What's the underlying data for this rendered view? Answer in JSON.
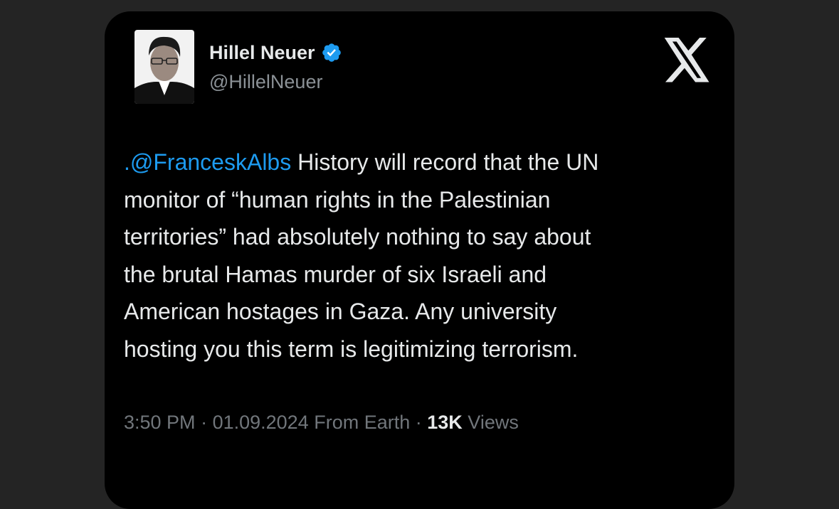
{
  "tweet": {
    "author_name": "Hillel Neuer",
    "author_handle": "@HillelNeuer",
    "verified_icon": "verified-badge-icon",
    "platform_icon": "x-logo-icon",
    "mention": ".@FranceskAlbs",
    "body": " History will record that the UN\nmonitor of “human rights in the Palestinian\nterritories” had absolutely nothing to say about\nthe brutal Hamas murder of six Israeli and\nAmerican hostages in Gaza. Any university\nhosting you this term is legitimizing terrorism.",
    "time": "3:50 PM",
    "date": "01.09.2024",
    "source": "From Earth",
    "separator": " · ",
    "views_count": "13K",
    "views_label": "Views"
  },
  "colors": {
    "page_bg": "#242424",
    "card_bg": "#000000",
    "text": "#e7e9ea",
    "muted": "#71767b",
    "accent": "#1d9bf0"
  }
}
